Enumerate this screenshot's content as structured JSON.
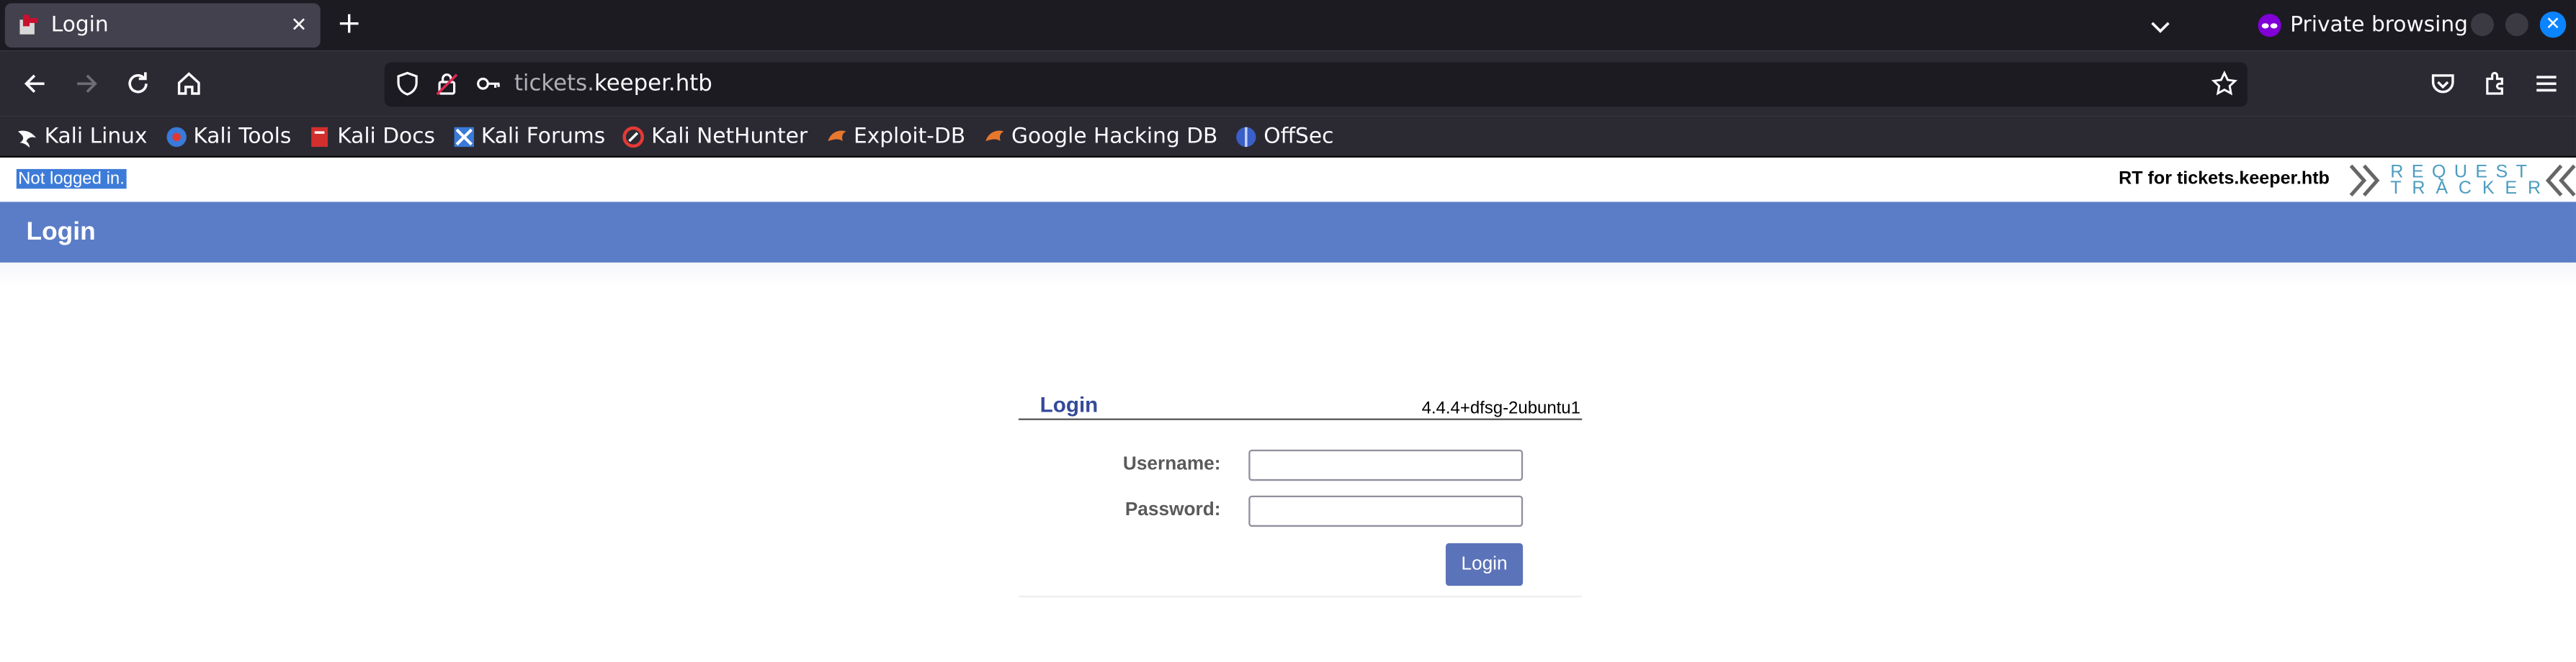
{
  "browser": {
    "tab": {
      "title": "Login",
      "close_symbol": "✕"
    },
    "new_tab_symbol": "+",
    "private_label": "Private browsing",
    "url": {
      "subdomain": "tickets.",
      "domain": "keeper.htb"
    },
    "bookmarks": [
      {
        "label": "Kali Linux",
        "icon": "kali-dragon-icon"
      },
      {
        "label": "Kali Tools",
        "icon": "kali-tools-icon"
      },
      {
        "label": "Kali Docs",
        "icon": "kali-docs-icon"
      },
      {
        "label": "Kali Forums",
        "icon": "kali-forums-icon"
      },
      {
        "label": "Kali NetHunter",
        "icon": "nethunter-icon"
      },
      {
        "label": "Exploit-DB",
        "icon": "exploit-db-icon"
      },
      {
        "label": "Google Hacking DB",
        "icon": "ghdb-icon"
      },
      {
        "label": "OffSec",
        "icon": "offsec-icon"
      }
    ],
    "colors": {
      "chrome_dark": "#1c1b22",
      "toolbar": "#2b2a33",
      "accent": "#0a84ff"
    }
  },
  "page": {
    "status": "Not logged in.",
    "rt_for": "RT for tickets.keeper.htb",
    "logo": {
      "word1": "REQUEST",
      "word2": "TRACKER"
    },
    "header_title": "Login",
    "login_box": {
      "title": "Login",
      "version": "4.4.4+dfsg-2ubuntu1",
      "username_label": "Username:",
      "password_label": "Password:",
      "username_value": "",
      "password_value": "",
      "submit_label": "Login"
    },
    "colors": {
      "header": "#5b7dc8",
      "button": "#5b73b8",
      "title": "#34499a",
      "logo": "#4c9cbf"
    }
  }
}
